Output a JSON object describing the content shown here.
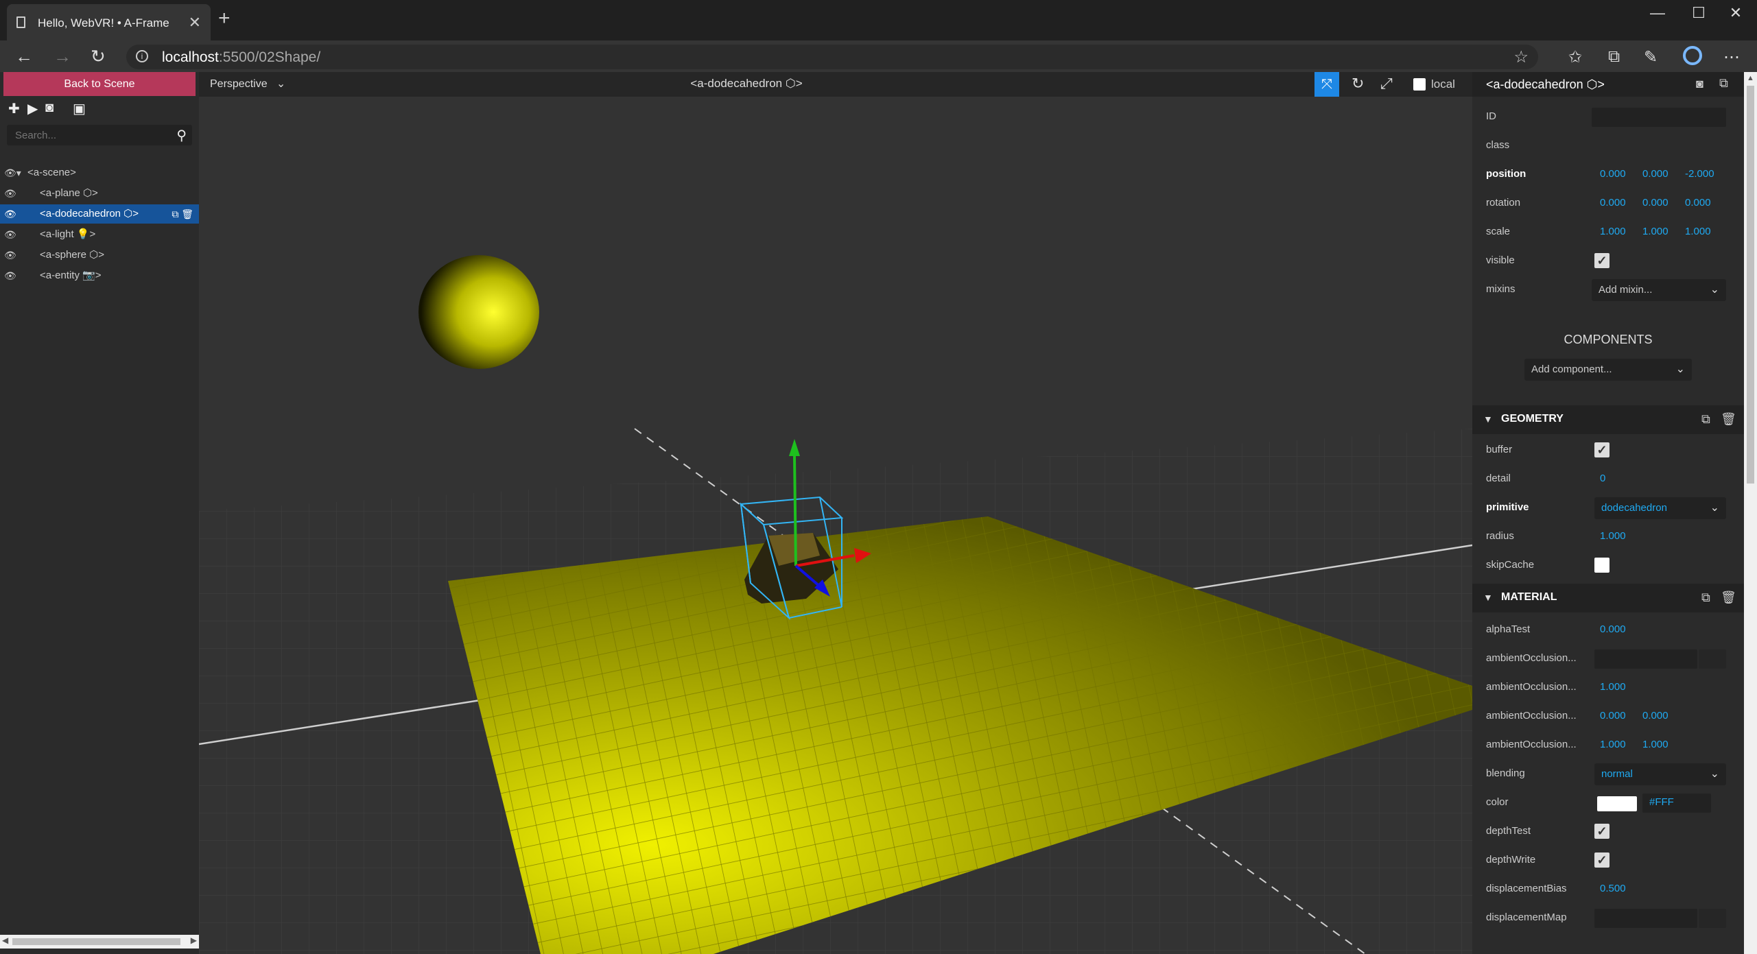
{
  "browser": {
    "tab_title": "Hello, WebVR! • A-Frame",
    "new_tab": "+",
    "url_host": "localhost",
    "url_path": ":5500/02Shape/",
    "window_controls": [
      "—",
      "☐",
      "✕"
    ]
  },
  "left_panel": {
    "back_button": "Back to Scene",
    "search_placeholder": "Search...",
    "tree": [
      {
        "label": "<a-scene>"
      },
      {
        "label": "<a-plane ⬡>"
      },
      {
        "label": "<a-dodecahedron ⬡>",
        "selected": true
      },
      {
        "label": "<a-light 💡>"
      },
      {
        "label": "<a-sphere ⬡>"
      },
      {
        "label": "<a-entity 📷>"
      }
    ]
  },
  "viewport": {
    "camera_mode": "Perspective",
    "title": "<a-dodecahedron ⬡>",
    "local_label": "local"
  },
  "inspector": {
    "title": "<a-dodecahedron ⬡>",
    "id_label": "ID",
    "class_label": "class",
    "position_label": "position",
    "position": [
      "0.000",
      "0.000",
      "-2.000"
    ],
    "rotation_label": "rotation",
    "rotation": [
      "0.000",
      "0.000",
      "0.000"
    ],
    "scale_label": "scale",
    "scale": [
      "1.000",
      "1.000",
      "1.000"
    ],
    "visible_label": "visible",
    "mixins_label": "mixins",
    "mixins_placeholder": "Add mixin...",
    "components_title": "COMPONENTS",
    "add_component": "Add component...",
    "geometry": {
      "title": "GEOMETRY",
      "buffer_label": "buffer",
      "detail_label": "detail",
      "detail": "0",
      "primitive_label": "primitive",
      "primitive": "dodecahedron",
      "radius_label": "radius",
      "radius": "1.000",
      "skipcache_label": "skipCache"
    },
    "material": {
      "title": "MATERIAL",
      "alphatest_label": "alphaTest",
      "alphatest": "0.000",
      "ao1_label": "ambientOcclusion...",
      "ao2_label": "ambientOcclusion...",
      "ao2": "1.000",
      "ao3_label": "ambientOcclusion...",
      "ao3": [
        "0.000",
        "0.000"
      ],
      "ao4_label": "ambientOcclusion...",
      "ao4": [
        "1.000",
        "1.000"
      ],
      "blending_label": "blending",
      "blending": "normal",
      "color_label": "color",
      "color": "#FFF",
      "depthtest_label": "depthTest",
      "depthwrite_label": "depthWrite",
      "displacementbias_label": "displacementBias",
      "displacementbias": "0.500",
      "displacementmap_label": "displacementMap"
    }
  },
  "colors": {
    "accent": "#1e88e5",
    "back_button": "#b5385a",
    "value": "#1faaf2",
    "selection": "#16549a",
    "plane": "#d4d400",
    "sphere": "#e8e800"
  }
}
